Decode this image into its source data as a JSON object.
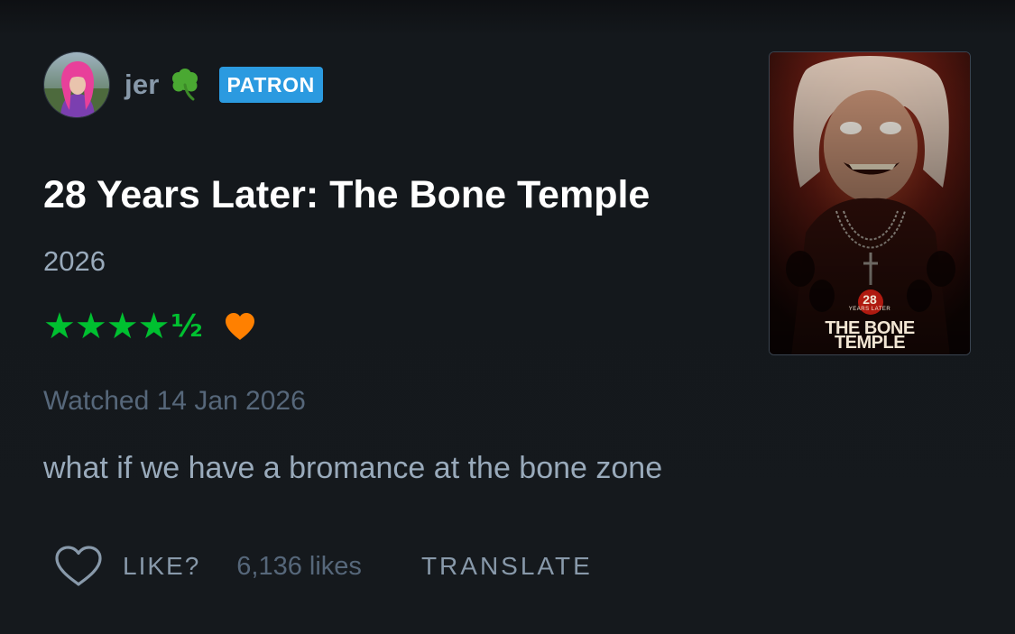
{
  "author": {
    "username": "jer",
    "emoji_icon": "shamrock-icon",
    "badge": "PATRON"
  },
  "film": {
    "title": "28 Years Later: The Bone Temple",
    "year": "2026",
    "poster": {
      "number": "28",
      "tagline": "YEARS LATER",
      "title_line1": "THE BONE",
      "title_line2": "TEMPLE"
    }
  },
  "review": {
    "rating_stars": "★★★★",
    "rating_half": "½",
    "rating_value": 4.5,
    "liked": true,
    "watched": "Watched 14 Jan 2026",
    "text": "what if we have a bromance at the bone zone"
  },
  "actions": {
    "like_label": "LIKE?",
    "likes_count": "6,136 likes",
    "translate_label": "TRANSLATE"
  },
  "colors": {
    "background": "#14181c",
    "star_green": "#00c030",
    "heart_orange": "#ff8000",
    "patron_blue": "#2b9ae0",
    "muted_text": "#8899aa"
  }
}
